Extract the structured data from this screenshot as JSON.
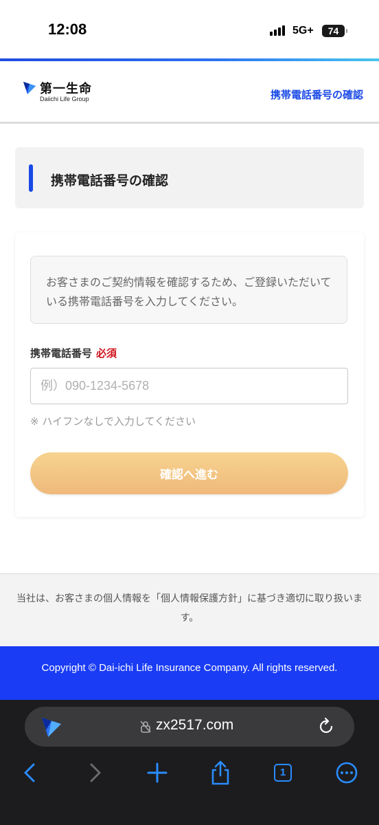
{
  "status_bar": {
    "time": "12:08",
    "network": "5G+",
    "battery": "74"
  },
  "header": {
    "logo_jp": "第一生命",
    "logo_en": "Daiichi Life Group",
    "page_link": "携帯電話番号の確認"
  },
  "page_title": "携帯電話番号の確認",
  "form": {
    "notice": "お客さまのご契約情報を確認するため、ご登録いただいている携帯電話番号を入力してください。",
    "label": "携帯電話番号",
    "required": "必須",
    "phone_value": "",
    "phone_placeholder": "例）090-1234-5678",
    "hint": "※ ハイフンなしで入力してください",
    "submit_label": "確認へ進む"
  },
  "footer": {
    "privacy_note": "当社は、お客さまの個人情報を「個人情報保護方針」に基づき適切に取り扱います。",
    "copyright": "Copyright © Dai-ichi Life Insurance Company. All rights reserved."
  },
  "browser": {
    "url": "zx2517.com",
    "tab_count": "1",
    "icons": [
      "back-icon",
      "forward-icon",
      "new-tab-icon",
      "share-icon",
      "tabs-icon",
      "more-icon"
    ]
  },
  "colors": {
    "brand_blue": "#1a49e6",
    "copyright_bg": "#1a3cf5",
    "required_red": "#d0121b",
    "button_gradient_top": "#f7d38f",
    "button_gradient_bottom": "#efb97a",
    "browser_accent": "#2a8cff"
  }
}
